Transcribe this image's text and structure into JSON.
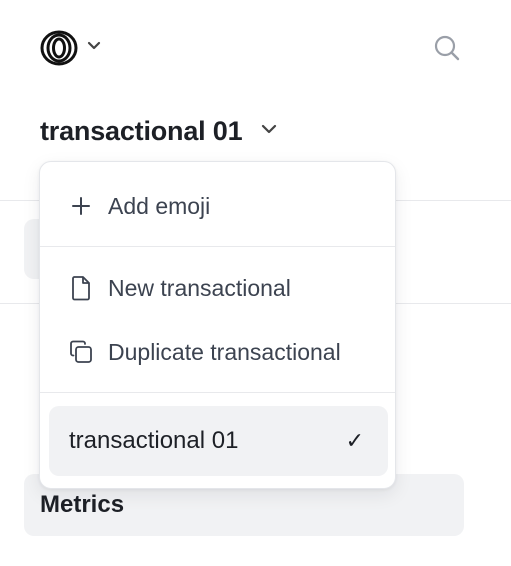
{
  "header": {
    "logo_icon": "concentric-rings-logo",
    "logo_dropdown_icon": "chevron-down-icon",
    "search_icon": "search-icon"
  },
  "title": {
    "text": "transactional 01",
    "dropdown_icon": "chevron-down-icon"
  },
  "menu": {
    "add_emoji": {
      "label": "Add emoji",
      "icon": "plus-icon"
    },
    "new": {
      "label": "New transactional",
      "icon": "document-icon"
    },
    "duplicate": {
      "label": "Duplicate transactional",
      "icon": "duplicate-icon"
    },
    "selected": {
      "label": "transactional 01",
      "check": "✓"
    }
  },
  "background": {
    "metrics_label": "Metrics"
  },
  "colors": {
    "text_primary": "#1d2026",
    "text_secondary": "#3c4350",
    "surface_muted": "#f1f2f4",
    "border": "#e4e6ea"
  }
}
